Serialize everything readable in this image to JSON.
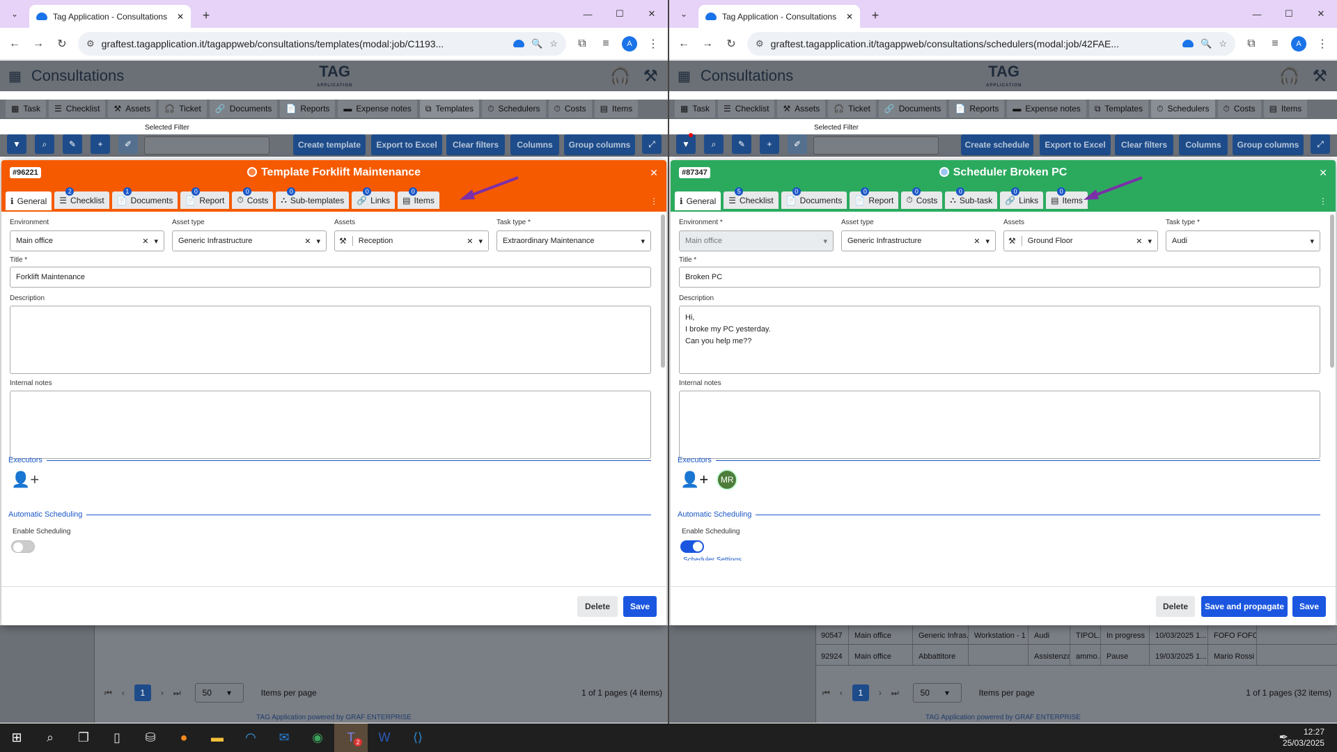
{
  "left": {
    "browser_tab_title": "Tag Application - Consultations",
    "url": "graftest.tagapplication.it/tagappweb/consultations/templates(modal:job/C1193...",
    "app_title": "Consultations",
    "logo_text": "TAG",
    "logo_sub": "APPLICATION",
    "menu": [
      "Task",
      "Checklist",
      "Assets",
      "Ticket",
      "Documents",
      "Reports",
      "Expense notes",
      "Templates",
      "Schedulers",
      "Costs",
      "Items"
    ],
    "active_menu": "Templates",
    "selected_filter_label": "Selected Filter",
    "buttons": [
      "Create template",
      "Export to Excel",
      "Clear filters",
      "Columns",
      "Group columns"
    ],
    "modal": {
      "color": "#f55a00",
      "id": "#96221",
      "title": "Template Forklift Maintenance",
      "tabs": [
        {
          "label": "General",
          "badge": ""
        },
        {
          "label": "Checklist",
          "badge": "2"
        },
        {
          "label": "Documents",
          "badge": "1"
        },
        {
          "label": "Report",
          "badge": "0"
        },
        {
          "label": "Costs",
          "badge": "0"
        },
        {
          "label": "Sub-templates",
          "badge": "0"
        },
        {
          "label": "Links",
          "badge": "0"
        },
        {
          "label": "Items",
          "badge": "0"
        }
      ],
      "environment_label": "Environment",
      "environment": "Main office",
      "asset_type_label": "Asset type",
      "asset_type": "Generic Infrastructure",
      "assets_label": "Assets",
      "assets": "Reception",
      "task_type_label": "Task type *",
      "task_type": "Extraordinary Maintenance",
      "title_label": "Title *",
      "title_value": "Forklift Maintenance",
      "description_label": "Description",
      "description": "",
      "internal_notes_label": "Internal notes",
      "executors_label": "Executors",
      "auto_sched_label": "Automatic Scheduling",
      "enable_sched_label": "Enable Scheduling",
      "scheduling_enabled": false,
      "delete_label": "Delete",
      "save_label": "Save"
    },
    "pager": {
      "page": "1",
      "per_page": "50",
      "items_per_page_label": "Items per page",
      "summary": "1 of 1 pages (4 items)"
    },
    "footer": "TAG Application powered by GRAF ENTERPRISE"
  },
  "right": {
    "browser_tab_title": "Tag Application - Consultations",
    "url": "graftest.tagapplication.it/tagappweb/consultations/schedulers(modal:job/42FAE...",
    "app_title": "Consultations",
    "logo_text": "TAG",
    "logo_sub": "APPLICATION",
    "menu": [
      "Task",
      "Checklist",
      "Assets",
      "Ticket",
      "Documents",
      "Reports",
      "Expense notes",
      "Templates",
      "Schedulers",
      "Costs",
      "Items"
    ],
    "active_menu": "Schedulers",
    "selected_filter_label": "Selected Filter",
    "buttons": [
      "Create schedule",
      "Export to Excel",
      "Clear filters",
      "Columns",
      "Group columns"
    ],
    "modal": {
      "color": "#2baa5e",
      "id": "#87347",
      "title": "Scheduler Broken PC",
      "tabs": [
        {
          "label": "General",
          "badge": ""
        },
        {
          "label": "Checklist",
          "badge": "5"
        },
        {
          "label": "Documents",
          "badge": "0"
        },
        {
          "label": "Report",
          "badge": "0"
        },
        {
          "label": "Costs",
          "badge": "0"
        },
        {
          "label": "Sub-task",
          "badge": "0"
        },
        {
          "label": "Links",
          "badge": "0"
        },
        {
          "label": "Items",
          "badge": "0"
        }
      ],
      "environment_label": "Environment *",
      "environment": "Main office",
      "asset_type_label": "Asset type",
      "asset_type": "Generic Infrastructure",
      "assets_label": "Assets",
      "assets": "Ground Floor",
      "task_type_label": "Task type *",
      "task_type": "Audi",
      "title_label": "Title *",
      "title_value": "Broken PC",
      "description_label": "Description",
      "description_lines": [
        "Hi,",
        "I broke my PC yesterday.",
        "Can you help me??"
      ],
      "internal_notes_label": "Internal notes",
      "executors_label": "Executors",
      "executor_initials": "MR",
      "auto_sched_label": "Automatic Scheduling",
      "enable_sched_label": "Enable Scheduling",
      "scheduling_enabled": true,
      "scheduler_settings_label": "Scheduler Settings",
      "delete_label": "Delete",
      "save_propagate_label": "Save and propagate",
      "save_label": "Save"
    },
    "table_rows": [
      [
        "90547",
        "Main office",
        "Generic Infras...",
        "Workstation - 1",
        "Audi",
        "TIPOL...",
        "In progress",
        "10/03/2025 1...",
        "FOFO FOFO"
      ],
      [
        "92924",
        "Main office",
        "Abbattitore",
        "",
        "Assistenza",
        "ammo...",
        "Pause",
        "19/03/2025 1...",
        "Mario Rossi"
      ]
    ],
    "pager": {
      "page": "1",
      "per_page": "50",
      "items_per_page_label": "Items per page",
      "summary": "1 of 1 pages (32 items)"
    },
    "footer": "TAG Application powered by GRAF ENTERPRISE"
  },
  "taskbar": {
    "time": "12:27",
    "date": "25/03/2025",
    "outlook_badge": "2"
  }
}
